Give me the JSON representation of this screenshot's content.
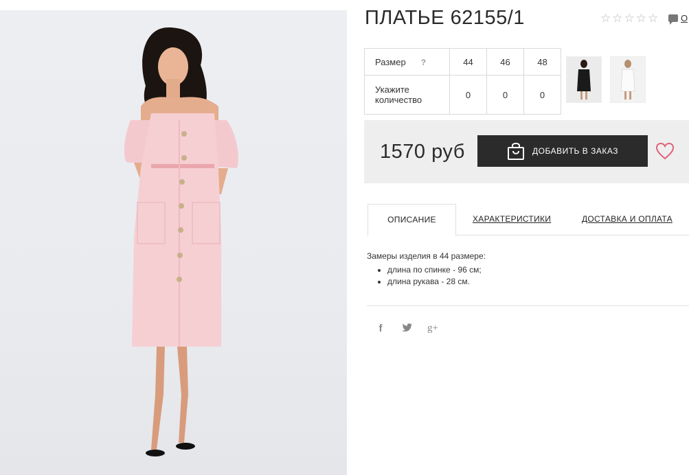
{
  "product": {
    "title": "ПЛАТЬЕ 62155/1",
    "comments_link": "О",
    "rating_stars": 5,
    "rating_value": 0
  },
  "sizes": {
    "size_label": "Размер",
    "size_help": "?",
    "qty_label": "Укажите количество",
    "columns": [
      {
        "size": "44",
        "qty": "0"
      },
      {
        "size": "46",
        "qty": "0"
      },
      {
        "size": "48",
        "qty": "0"
      }
    ]
  },
  "buy": {
    "price": "1570 руб",
    "add_button": "ДОБАВИТЬ В ЗАКАЗ"
  },
  "tabs": {
    "description": "ОПИСАНИЕ",
    "characteristics": "ХАРАКТЕРИСТИКИ",
    "delivery": "ДОСТАВКА И ОПЛАТА"
  },
  "description": {
    "intro": "Замеры изделия в 44 размере:",
    "items": [
      "длина по спинке - 96 см;",
      "длина рукава - 28 см."
    ]
  },
  "social": {
    "icons": [
      "facebook-icon",
      "twitter-icon",
      "google-plus-icon"
    ],
    "glyphs": [
      "f",
      "t",
      "g+"
    ]
  },
  "colors": {
    "dark_button": "#2b2b2b",
    "heart": "#e0607a",
    "dress_pink": "#f6cfd3",
    "panel_gray": "#eeeeee"
  }
}
